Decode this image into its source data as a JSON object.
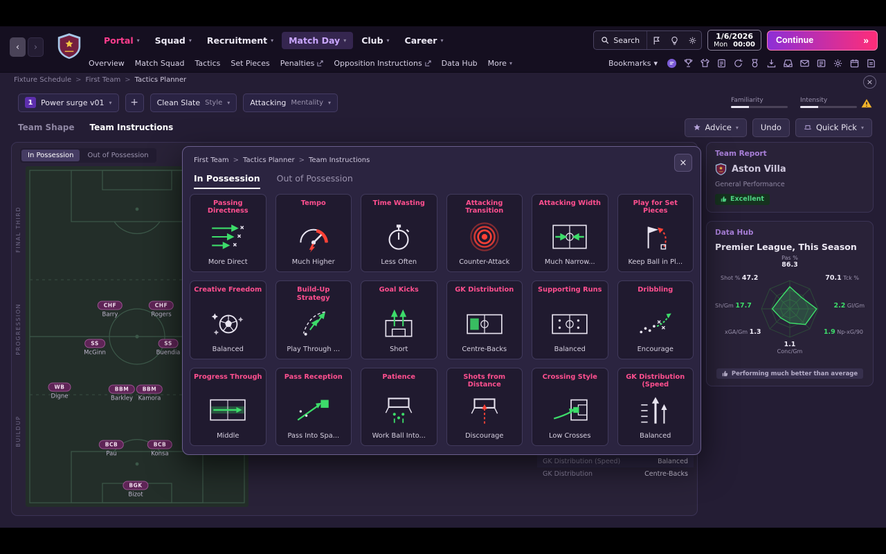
{
  "header": {
    "nav": [
      {
        "label": "Portal",
        "style": "pink"
      },
      {
        "label": "Squad",
        "style": "normal"
      },
      {
        "label": "Recruitment",
        "style": "normal"
      },
      {
        "label": "Match Day",
        "style": "purple"
      },
      {
        "label": "Club",
        "style": "normal"
      },
      {
        "label": "Career",
        "style": "normal"
      }
    ],
    "search_label": "Search",
    "date": "1/6/2026",
    "day": "Mon",
    "time": "00:00",
    "continue_label": "Continue"
  },
  "subnav": {
    "items": [
      {
        "label": "Overview",
        "external": false,
        "chevron": false
      },
      {
        "label": "Match Squad",
        "external": false,
        "chevron": false
      },
      {
        "label": "Tactics",
        "external": false,
        "chevron": false
      },
      {
        "label": "Set Pieces",
        "external": false,
        "chevron": false
      },
      {
        "label": "Penalties",
        "external": true,
        "chevron": false
      },
      {
        "label": "Opposition Instructions",
        "external": true,
        "chevron": false
      },
      {
        "label": "Data Hub",
        "external": false,
        "chevron": false
      },
      {
        "label": "More",
        "external": false,
        "chevron": true
      }
    ],
    "bookmarks_label": "Bookmarks",
    "icons": [
      "chat-icon",
      "trophy-icon",
      "shirt-icon",
      "clipboard-icon",
      "refresh-icon",
      "medal-icon",
      "download-icon",
      "tray-icon",
      "mail-icon",
      "news-icon",
      "gear-icon",
      "calendar-icon",
      "notes-icon"
    ]
  },
  "breadcrumb": {
    "items": [
      "Fixture Schedule",
      "First Team",
      "Tactics Planner"
    ]
  },
  "tactics_bar": {
    "preset_number": "1",
    "preset_name": "Power surge v01",
    "style_value": "Clean Slate",
    "style_label": "Style",
    "mentality_value": "Attacking",
    "mentality_label": "Mentality",
    "familiarity_label": "Familiarity",
    "intensity_label": "Intensity"
  },
  "view_tabs": {
    "team_shape": "Team Shape",
    "team_instructions": "Team Instructions",
    "advice": "Advice",
    "undo": "Undo",
    "quick_pick": "Quick Pick"
  },
  "pitch": {
    "tabs": [
      "In Possession",
      "Out of Possession"
    ],
    "zones": [
      "FINAL THIRD",
      "PROGRESSION",
      "BUILDUP"
    ],
    "players": [
      {
        "role": "CHF",
        "name": "Barry"
      },
      {
        "role": "CHF",
        "name": "Rogers"
      },
      {
        "role": "SS",
        "name": "McGinn"
      },
      {
        "role": "SS",
        "name": "Buendia"
      },
      {
        "role": "WB",
        "name": "Digne"
      },
      {
        "role": "BBM",
        "name": "Barkley"
      },
      {
        "role": "BBM",
        "name": "Kamora"
      },
      {
        "role": "BCB",
        "name": "Pau"
      },
      {
        "role": "BCB",
        "name": "Konsa"
      },
      {
        "role": "BGK",
        "name": "Bizot"
      }
    ]
  },
  "modal": {
    "breadcrumb": [
      "First Team",
      "Tactics Planner",
      "Team Instructions"
    ],
    "tabs": [
      "In Possession",
      "Out of Possession"
    ],
    "cards": [
      {
        "title": "Passing Directness",
        "value": "More Direct",
        "icon": "passing-directness"
      },
      {
        "title": "Tempo",
        "value": "Much Higher",
        "icon": "tempo"
      },
      {
        "title": "Time Wasting",
        "value": "Less Often",
        "icon": "time-wasting"
      },
      {
        "title": "Attacking Transition",
        "value": "Counter-Attack",
        "icon": "attacking-transition"
      },
      {
        "title": "Attacking Width",
        "value": "Much Narrow...",
        "icon": "attacking-width"
      },
      {
        "title": "Play for Set Pieces",
        "value": "Keep Ball in Pl...",
        "icon": "set-pieces"
      },
      {
        "title": "Creative Freedom",
        "value": "Balanced",
        "icon": "creative-freedom"
      },
      {
        "title": "Build-Up Strategy",
        "value": "Play Through ...",
        "icon": "build-up"
      },
      {
        "title": "Goal Kicks",
        "value": "Short",
        "icon": "goal-kicks"
      },
      {
        "title": "GK Distribution",
        "value": "Centre-Backs",
        "icon": "gk-distribution"
      },
      {
        "title": "Supporting Runs",
        "value": "Balanced",
        "icon": "supporting-runs"
      },
      {
        "title": "Dribbling",
        "value": "Encourage",
        "icon": "dribbling"
      },
      {
        "title": "Progress Through",
        "value": "Middle",
        "icon": "progress-through"
      },
      {
        "title": "Pass Reception",
        "value": "Pass Into Spa...",
        "icon": "pass-reception"
      },
      {
        "title": "Patience",
        "value": "Work Ball Into...",
        "icon": "patience"
      },
      {
        "title": "Shots from Distance",
        "value": "Discourage",
        "icon": "shots-distance"
      },
      {
        "title": "Crossing Style",
        "value": "Low Crosses",
        "icon": "crossing-style"
      },
      {
        "title": "GK Distribution (Speed",
        "value": "Balanced",
        "icon": "gk-distribution-speed"
      }
    ]
  },
  "background_rows": [
    {
      "label": "GK Distribution (Speed)",
      "value": "Balanced"
    },
    {
      "label": "GK Distribution",
      "value": "Centre-Backs"
    }
  ],
  "sidebar": {
    "team_report": {
      "title": "Team Report",
      "team": "Aston Villa",
      "perf_label": "General Performance",
      "perf_value": "Excellent"
    },
    "data_hub": {
      "title": "Data Hub",
      "subtitle": "Premier League, This Season",
      "stats": {
        "top": {
          "label": "Pas %",
          "value": "86.3",
          "color": "white"
        },
        "top_right": {
          "label": "Tck %",
          "value": "70.1",
          "color": "white"
        },
        "right": {
          "label": "Gl/Gm",
          "value": "2.2",
          "color": "green"
        },
        "bottom_right": {
          "label": "Np-xG/90",
          "value": "1.9",
          "color": "green"
        },
        "bottom": {
          "label": "Conc/Gm",
          "value": "1.1",
          "color": "white"
        },
        "bottom_left": {
          "label": "xGA/Gm",
          "value": "1.3",
          "color": "white"
        },
        "left": {
          "label": "Sh/Gm",
          "value": "17.7",
          "color": "green"
        },
        "top_left": {
          "label": "Shot %",
          "value": "47.2",
          "color": "white"
        }
      },
      "badge": "Performing much better than average"
    }
  },
  "chart_data": {
    "type": "radar",
    "title": "Premier League, This Season",
    "axes": [
      "Pas %",
      "Tck %",
      "Gl/Gm",
      "Np-xG/90",
      "Conc/Gm",
      "xGA/Gm",
      "Sh/Gm",
      "Shot %"
    ],
    "values": [
      86.3,
      70.1,
      2.2,
      1.9,
      1.1,
      1.3,
      17.7,
      47.2
    ],
    "legend_position": "none",
    "accent_color": "#3ddc6a"
  }
}
